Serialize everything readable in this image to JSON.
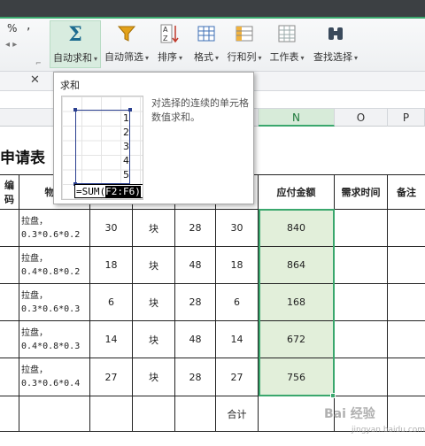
{
  "ribbon": {
    "percent_symbol": "%",
    "comma_symbol": ",",
    "buttons": [
      {
        "label": "自动求和",
        "icon": "sigma-icon"
      },
      {
        "label": "自动筛选",
        "icon": "filter-icon"
      },
      {
        "label": "排序",
        "icon": "sort-icon"
      },
      {
        "label": "格式",
        "icon": "format-icon"
      },
      {
        "label": "行和列",
        "icon": "rows-columns-icon"
      },
      {
        "label": "工作表",
        "icon": "worksheet-icon"
      },
      {
        "label": "查找选择",
        "icon": "binoculars-icon"
      }
    ]
  },
  "tab_close": "✕",
  "columns": [
    "N",
    "O",
    "P"
  ],
  "sheet": {
    "title": "申请表",
    "headers": [
      "编码",
      "物料",
      "应付金额",
      "需求时间",
      "备注"
    ],
    "rows": [
      {
        "material": "拉盘，\n0.3*0.6*0.2",
        "qty": "30",
        "unit": "块",
        "price": "28",
        "qty2": "30",
        "amount": "840"
      },
      {
        "material": "拉盘，\n0.4*0.8*0.2",
        "qty": "18",
        "unit": "块",
        "price": "48",
        "qty2": "18",
        "amount": "864"
      },
      {
        "material": "拉盘，\n0.3*0.6*0.3",
        "qty": "6",
        "unit": "块",
        "price": "28",
        "qty2": "6",
        "amount": "168"
      },
      {
        "material": "拉盘，\n0.4*0.8*0.3",
        "qty": "14",
        "unit": "块",
        "price": "48",
        "qty2": "14",
        "amount": "672"
      },
      {
        "material": "拉盘，\n0.3*0.6*0.4",
        "qty": "27",
        "unit": "块",
        "price": "28",
        "qty2": "27",
        "amount": "756"
      }
    ],
    "total_label": "合计"
  },
  "tooltip": {
    "title": "求和",
    "description": "对选择的连续的单元格数值求和。",
    "preview_values": [
      "1",
      "2",
      "3",
      "4",
      "5"
    ],
    "formula_prefix": "=SUM(",
    "formula_range": "F2:F6",
    "formula_suffix": ")"
  },
  "watermark": {
    "text": "Bai 经验",
    "sub": "jingyan.baidu.com"
  }
}
